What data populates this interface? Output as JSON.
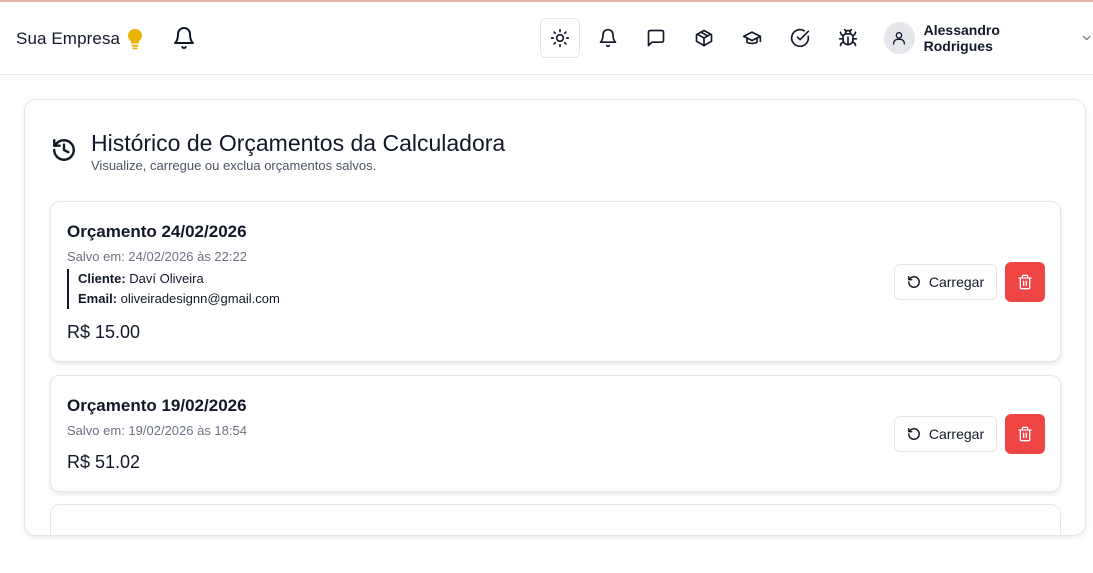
{
  "header": {
    "brand_name": "Sua Empresa",
    "user_name": "Alessandro Rodrigues",
    "icons": [
      "lightbulb-icon",
      "bell-icon",
      "sun-icon",
      "bell-icon",
      "message-icon",
      "package-icon",
      "graduation-cap-icon",
      "check-circle-icon",
      "bug-icon",
      "user-icon",
      "chevron-down-icon"
    ],
    "accent_bulb_color": "#eab308"
  },
  "panel": {
    "title": "Histórico de Orçamentos da Calculadora",
    "subtitle": "Visualize, carregue ou exclua orçamentos salvos."
  },
  "quotes": [
    {
      "title": "Orçamento 24/02/2026",
      "saved": "Salvo em: 24/02/2026 às 22:22",
      "client_label": "Cliente:",
      "client_value": "Daví Oliveira",
      "email_label": "Email:",
      "email_value": "oliveiradesignn@gmail.com",
      "total": "R$ 15.00",
      "load_label": "Carregar"
    },
    {
      "title": "Orçamento 19/02/2026",
      "saved": "Salvo em: 19/02/2026 às 18:54",
      "total": "R$ 51.02",
      "load_label": "Carregar"
    }
  ],
  "colors": {
    "delete_button": "#ef4444",
    "border": "#e5e7eb"
  }
}
